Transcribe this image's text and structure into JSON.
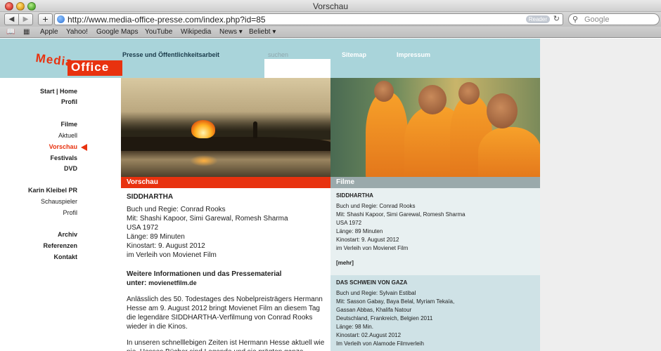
{
  "window": {
    "title": "Vorschau"
  },
  "toolbar": {
    "url": "http://www.media-office-presse.com/index.php?id=85",
    "reader_label": "Reader",
    "search_placeholder": "Google"
  },
  "bookmarks": [
    "Apple",
    "Yahoo!",
    "Google Maps",
    "YouTube",
    "Wikipedia",
    "News ▾",
    "Beliebt ▾"
  ],
  "site": {
    "logo_word1": "Media",
    "logo_word2": "Office",
    "topnav": [
      "Presse und Öffentlichkeitsarbeit",
      "suchen",
      "Sitemap",
      "Impressum"
    ],
    "leftnav": [
      {
        "label": "Start | Home"
      },
      {
        "label": "Profil"
      },
      {
        "label": "Filme"
      },
      {
        "label": "Aktuell"
      },
      {
        "label": "Vorschau"
      },
      {
        "label": "Festivals"
      },
      {
        "label": "DVD"
      },
      {
        "label": "Karin Kleibel PR"
      },
      {
        "label": "Schauspieler"
      },
      {
        "label": "Profil"
      },
      {
        "label": "Archiv"
      },
      {
        "label": "Referenzen"
      },
      {
        "label": "Kontakt"
      }
    ],
    "bar_left": "Vorschau",
    "bar_right": "Filme"
  },
  "article": {
    "title": "SIDDHARTHA",
    "lines": [
      "Buch und Regie: Conrad Rooks",
      "Mit: Shashi Kapoor, Simi Garewal, Romesh Sharma",
      "USA 1972",
      "Länge: 89 Minuten",
      "Kinostart: 9. August 2012",
      "im Verleih von Movienet Film"
    ],
    "subhead": "Weitere Informationen und das Pressematerial",
    "subhead2": "unter:",
    "link": "movienetfilm.de",
    "para1": "Anlässlich des 50. Todestages des Nobelpreisträgers Hermann Hesse am 9. August 2012 bringt Movienet Film an diesem Tag die legendäre SIDDHARTHA-Verfilmung von Conrad Rooks wieder in die Kinos.",
    "para2": "In unseren schnelllebigen Zeiten ist Hermann Hesse aktuell wie nie. Hesses Bücher sind Legende und sie prägten ganze"
  },
  "films": [
    {
      "title": "SIDDHARTHA",
      "lines": [
        "Buch und Regie: Conrad Rooks",
        "Mit: Shashi Kapoor, Simi Garewal, Romesh Sharma",
        "USA 1972",
        "Länge: 89 Minuten",
        "Kinostart: 9. August 2012",
        "im Verleih von Movienet Film"
      ],
      "more": "[mehr]"
    },
    {
      "title": "DAS SCHWEIN VON GAZA",
      "lines": [
        "Buch und Regie: Sylvain Estibal",
        "Mit: Sasson Gabay, Baya Belal, Myriam Tekaïa,",
        "Gassan Abbas, Khalifa Natour",
        "Deutschland, Frankreich, Belgien 2011",
        "Länge: 98 Min.",
        "Kinostart: 02.August 2012",
        "Im Verleih von Alamode Filmverleih"
      ]
    }
  ],
  "colors": {
    "accent": "#e8320f",
    "header": "#a9d4da",
    "filme_bar": "#9aa9ab"
  }
}
